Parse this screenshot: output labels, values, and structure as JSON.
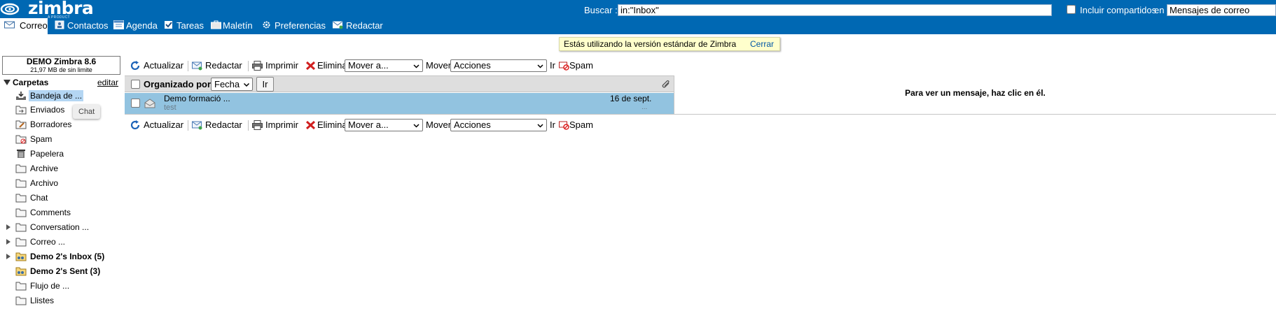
{
  "logo": {
    "text": "zimbra",
    "subtext": "A PRODUCT"
  },
  "search": {
    "label": "Buscar :",
    "value": "in:\"Inbox\"",
    "include_shared_label": "Incluir compartidos",
    "in_label": "en",
    "scope_value": "Mensajes de correo"
  },
  "apptabs": [
    {
      "label": "Correo",
      "icon": "mail-icon"
    },
    {
      "label": "Contactos",
      "icon": "contacts-icon"
    },
    {
      "label": "Agenda",
      "icon": "calendar-icon"
    },
    {
      "label": "Tareas",
      "icon": "tasks-icon"
    },
    {
      "label": "Maletín",
      "icon": "briefcase-icon"
    },
    {
      "label": "Preferencias",
      "icon": "gear-icon"
    },
    {
      "label": "Redactar",
      "icon": "compose-icon"
    }
  ],
  "banner": {
    "text": "Estás utilizando la versión estándar de Zimbra",
    "close_label": "Cerrar"
  },
  "quota": {
    "title": "DEMO Zimbra 8.6",
    "subtitle": "21,97 MB de sin limite"
  },
  "folders": {
    "title": "Carpetas",
    "edit_label": "editar",
    "items": [
      {
        "label": "Bandeja de ...",
        "icon": "inbox-icon",
        "selected": true
      },
      {
        "label": "Enviados",
        "icon": "sent-icon"
      },
      {
        "label": "Borradores",
        "icon": "drafts-icon"
      },
      {
        "label": "Spam",
        "icon": "spam-icon"
      },
      {
        "label": "Papelera",
        "icon": "trash-icon"
      },
      {
        "label": "Archive",
        "icon": "folder-icon"
      },
      {
        "label": "Archivo",
        "icon": "folder-icon"
      },
      {
        "label": "Chat",
        "icon": "folder-icon"
      },
      {
        "label": "Comments",
        "icon": "folder-icon"
      },
      {
        "label": "Conversation ...",
        "icon": "folder-icon",
        "expandable": true
      },
      {
        "label": "Correo ...",
        "icon": "folder-icon",
        "expandable": true
      },
      {
        "label": "Demo 2's Inbox (5)",
        "icon": "shared-folder-icon",
        "expandable": true,
        "bold": true
      },
      {
        "label": "Demo 2's Sent (3)",
        "icon": "shared-folder-icon",
        "bold": true
      },
      {
        "label": "Flujo de ...",
        "icon": "folder-icon"
      },
      {
        "label": "Llistes",
        "icon": "folder-icon"
      }
    ]
  },
  "tooltip": {
    "text": "Chat"
  },
  "toolbar": {
    "refresh_label": "Actualizar",
    "compose_label": "Redactar",
    "print_label": "Imprimir",
    "delete_label": "Eliminar",
    "move_select_value": "Mover a...",
    "move_label": "Mover",
    "actions_select_value": "Acciones",
    "go_label": "Ir",
    "spam_label": "Spam"
  },
  "list": {
    "sort_label": "Organizado por:",
    "sort_value": "Fecha",
    "sort_go_label": "Ir",
    "messages": [
      {
        "from": "Demo formació ...",
        "snippet": "test",
        "date": "16 de sept.",
        "size": "..."
      }
    ]
  },
  "reading_pane": {
    "hint": "Para ver un mensaje, haz clic en él."
  }
}
